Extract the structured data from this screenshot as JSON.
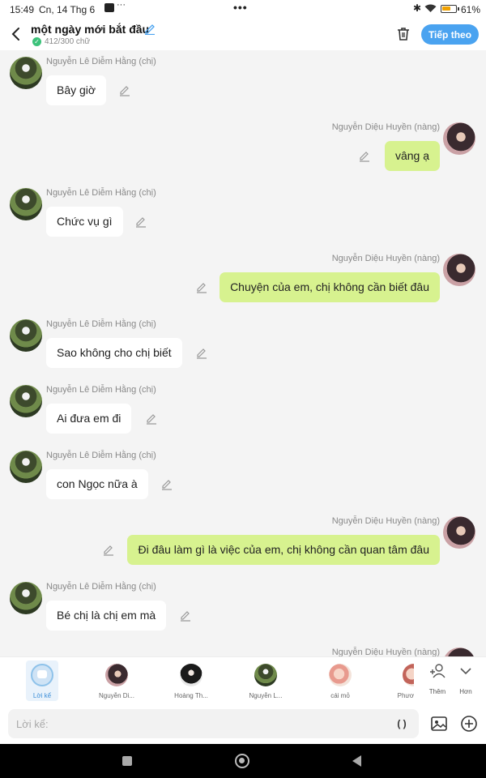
{
  "status_bar": {
    "time": "15:49",
    "date": "Cn, 14 Thg 6",
    "small_dots": "···",
    "center_dots": "•••",
    "battery_percent": "61%",
    "battery_level": 0.61
  },
  "header": {
    "title": "một ngày mới bắt đầu",
    "word_count": "412/300 chữ",
    "next_button": "Tiếp theo",
    "colors": {
      "accent": "#4aa3f0",
      "check": "#3cc27a"
    }
  },
  "messages": [
    {
      "side": "left",
      "sender": "Nguyễn Lê Diễm Hằng (chị)",
      "text": "Bây giờ"
    },
    {
      "side": "right",
      "sender": "Nguyễn Diệu Huyền (nàng)",
      "text": "vâng ạ"
    },
    {
      "side": "left",
      "sender": "Nguyễn Lê Diễm Hằng (chị)",
      "text": "Chức vụ gì"
    },
    {
      "side": "right",
      "sender": "Nguyễn Diệu Huyền (nàng)",
      "text": "Chuyện của em, chị không cần biết đâu"
    },
    {
      "side": "left",
      "sender": "Nguyễn Lê Diễm Hằng (chị)",
      "text": "Sao không cho chị biết"
    },
    {
      "side": "left",
      "sender": "Nguyễn Lê Diễm Hằng (chị)",
      "text": "Ai đưa em đi"
    },
    {
      "side": "left",
      "sender": "Nguyễn Lê Diễm Hằng (chị)",
      "text": "con Ngọc nữa à"
    },
    {
      "side": "right",
      "sender": "Nguyễn Diệu Huyền (nàng)",
      "text": "Đi đâu làm gì là việc của em, chị không cần quan tâm đâu"
    },
    {
      "side": "left",
      "sender": "Nguyễn Lê Diễm Hằng (chị)",
      "text": "Bé chị là chị em mà"
    },
    {
      "side": "right",
      "sender": "Nguyễn Diệu Huyền (nàng)",
      "text": ""
    }
  ],
  "bubble_colors": {
    "left": "#ffffff",
    "right": "#d7f28f"
  },
  "character_bar": {
    "items": [
      {
        "label": "Lời kể",
        "icon": "narration-icon",
        "active": true
      },
      {
        "label": "Nguyễn Di...",
        "icon": "avatar-huyen"
      },
      {
        "label": "Hoàng Th...",
        "icon": "avatar-hoang"
      },
      {
        "label": "Nguyễn L...",
        "icon": "avatar-hang"
      },
      {
        "label": "cái mỏ",
        "icon": "avatar-caimo"
      },
      {
        "label": "Phươ",
        "icon": "avatar-phuong"
      }
    ],
    "add_label": "Thêm",
    "more_label": "Hơn"
  },
  "input": {
    "placeholder": "Lời kể:",
    "value": "",
    "paren_label": "( )"
  }
}
